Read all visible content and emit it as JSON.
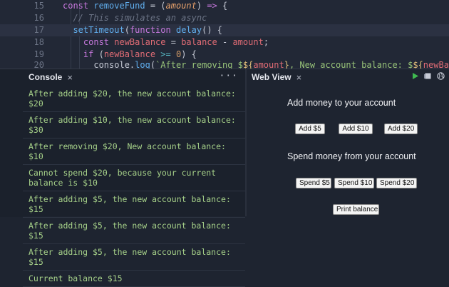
{
  "editor": {
    "lines": [
      {
        "num": "15",
        "parts": [
          [
            "kw",
            "const "
          ],
          [
            "fn",
            "removeFund"
          ],
          [
            "punc",
            " = ("
          ],
          [
            "it",
            "amount"
          ],
          [
            "punc",
            ") "
          ],
          [
            "kw",
            "=>"
          ],
          [
            "punc",
            " {"
          ]
        ]
      },
      {
        "num": "16",
        "parts": [
          [
            "cm",
            "  // This simulates an async"
          ]
        ]
      },
      {
        "num": "17",
        "parts": [
          [
            "fn",
            "  setTimeout"
          ],
          [
            "punc",
            "("
          ],
          [
            "kw",
            "function "
          ],
          [
            "fn",
            "delay"
          ],
          [
            "punc",
            "() {"
          ]
        ],
        "active": true
      },
      {
        "num": "18",
        "parts": [
          [
            "kw",
            "    const "
          ],
          [
            "id",
            "newBalance"
          ],
          [
            "punc",
            " = "
          ],
          [
            "id",
            "balance"
          ],
          [
            "punc",
            " - "
          ],
          [
            "id",
            "amount"
          ],
          [
            "punc",
            ";"
          ]
        ]
      },
      {
        "num": "19",
        "parts": [
          [
            "kw",
            "    if "
          ],
          [
            "punc",
            "("
          ],
          [
            "id",
            "newBalance"
          ],
          [
            "op",
            " >= "
          ],
          [
            "num",
            "0"
          ],
          [
            "punc",
            ") {"
          ]
        ]
      },
      {
        "num": "20",
        "parts": [
          [
            "punc",
            "      console."
          ],
          [
            "fn",
            "log"
          ],
          [
            "punc",
            "("
          ],
          [
            "str",
            "`After removing $"
          ],
          [
            "tpl",
            "${"
          ],
          [
            "tplv",
            "amount"
          ],
          [
            "tpl",
            "}"
          ],
          [
            "str",
            ", New account balance: $"
          ],
          [
            "tpl",
            "${"
          ],
          [
            "tplv",
            "newBalance"
          ],
          [
            "tpl",
            "}"
          ],
          [
            "str",
            "`"
          ],
          [
            "punc",
            ");"
          ]
        ]
      }
    ]
  },
  "console": {
    "title": "Console",
    "close": "×",
    "more": "···",
    "logs": [
      "After adding $20, the new account balance: $20",
      "After adding $10, the new account balance: $30",
      "After removing $20, New account balance: $10",
      "Cannot spend $20, because your current balance is $10",
      "After adding $5, the new account balance: $15",
      "After adding $5, the new account balance: $15",
      "After adding $5, the new account balance: $15",
      "Current balance $15"
    ]
  },
  "webview": {
    "title": "Web View",
    "close": "×",
    "add_heading": "Add money to your account",
    "add_buttons": [
      "Add $5",
      "Add $10",
      "Add $20"
    ],
    "spend_heading": "Spend money from your account",
    "spend_buttons": [
      "Spend $5",
      "Spend $10",
      "Spend $20"
    ],
    "print_button": "Print balance",
    "icons": [
      "play-icon",
      "stop-icon",
      "globe-icon"
    ],
    "accent": "#3fb950"
  }
}
